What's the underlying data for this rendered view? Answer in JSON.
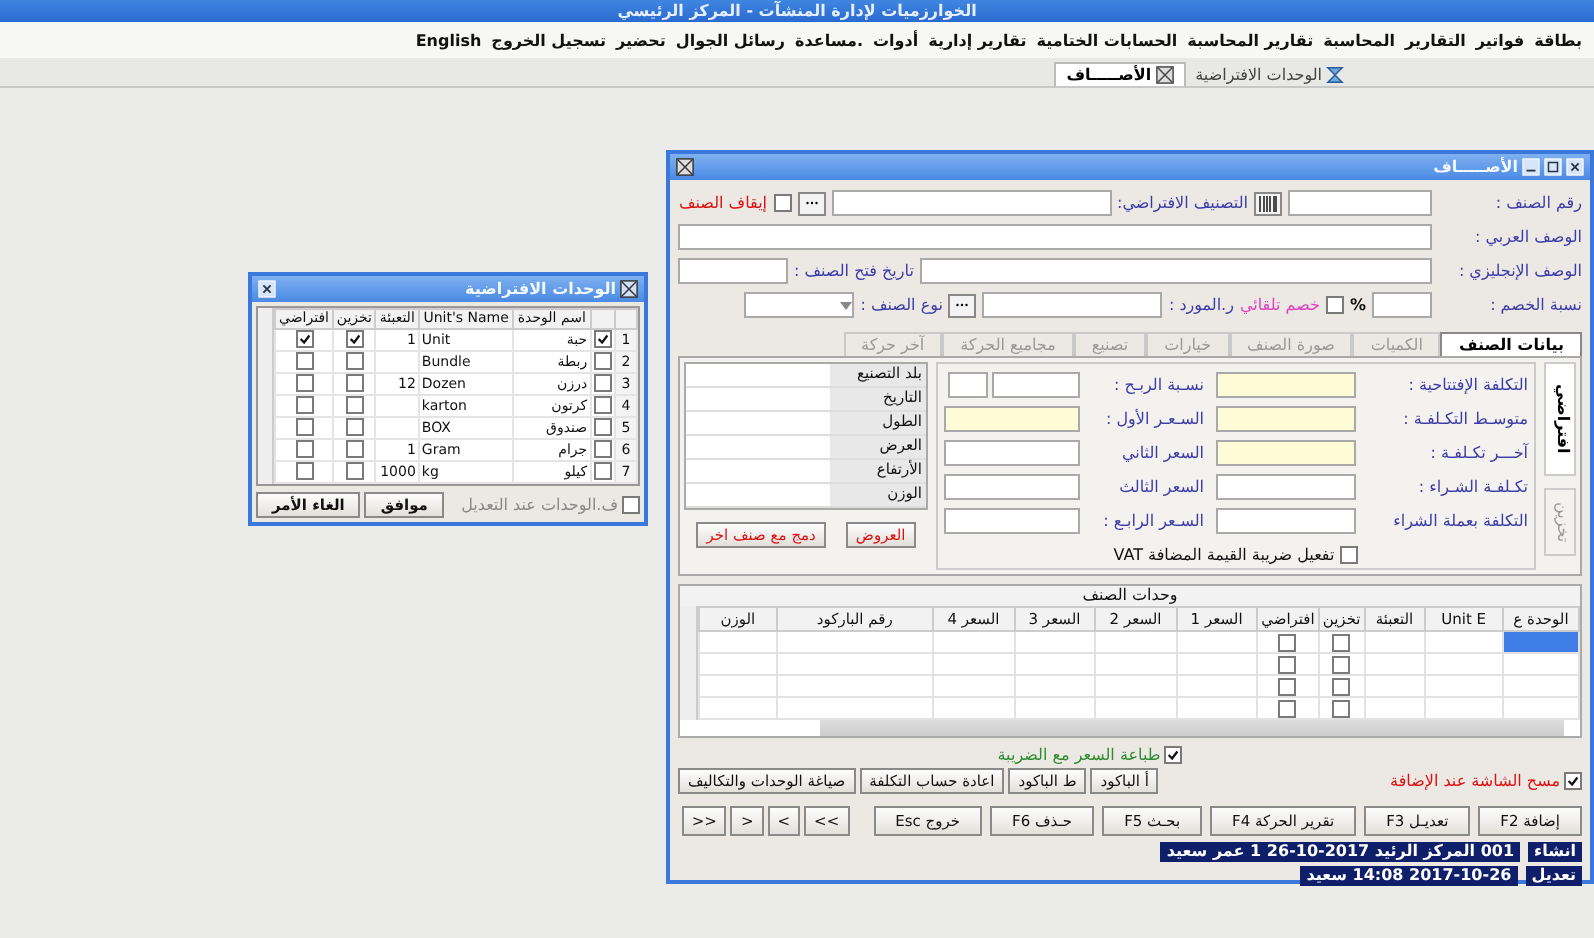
{
  "app_title": "الخوارزميات لإدارة المنشآت - المركز الرئيسي",
  "menu": [
    "بطاقة",
    "فواتير",
    "التقارير",
    "المحاسبة",
    "تقارير المحاسبة",
    "الحسابات الختامية",
    "تقارير إدارية",
    "أدوات",
    ".مساعدة",
    "رسائل الجوال",
    "تحضير",
    "تسجيل الخروج",
    "English"
  ],
  "doc_tabs": [
    {
      "label": "الوحدات الافتراضية",
      "selected": false
    },
    {
      "label": "الأصـــــاف",
      "selected": true
    }
  ],
  "items_window": {
    "title": "الأصـــــاف",
    "item_no": {
      "label": "رقم الصنف :"
    },
    "default_category": {
      "label": "التصنيف الافتراضي:"
    },
    "stop_item": {
      "label": "إيقاف الصنف",
      "checked": false
    },
    "arabic_desc": {
      "label": "الوصف العربي :"
    },
    "english_desc": {
      "label": "الوصف الإنجليزي :"
    },
    "open_date": {
      "label": "تاريخ فتح الصنف :"
    },
    "discount": {
      "label": "نسبة الخصم :",
      "unit": "%"
    },
    "auto_discount": {
      "label": "خصم تلقائي",
      "checked": false
    },
    "supplier": {
      "label": "ر.المورد :"
    },
    "item_type": {
      "label": "نوع الصنف :"
    },
    "tabs": [
      {
        "label": "بيانات الصنف",
        "selected": true
      },
      {
        "label": "الكميات",
        "selected": false
      },
      {
        "label": "صورة الصنف",
        "selected": false
      },
      {
        "label": "خيارات",
        "selected": false
      },
      {
        "label": "تصنيع",
        "selected": false
      },
      {
        "label": "مجاميع الحركة",
        "selected": false
      },
      {
        "label": "آخر حركة",
        "selected": false
      }
    ],
    "side_tabs": [
      {
        "label": "افتراضي",
        "selected": true
      },
      {
        "label": "تخزين",
        "selected": false
      }
    ],
    "cost_fields": [
      {
        "label": "التكلفة الإفتتاحية :",
        "highlighted": true
      },
      {
        "label": "متوسـط التكـلفـة :",
        "highlighted": true
      },
      {
        "label": "آخـــر تكـلفـة :",
        "highlighted": true
      },
      {
        "label": "تكـلفـة الشـراء :",
        "highlighted": false
      },
      {
        "label": "التكلفة بعملة الشراء",
        "highlighted": false
      }
    ],
    "price_fields": [
      {
        "label": "نسـبة الربـح :",
        "kind": "split",
        "highlighted": false
      },
      {
        "label": "السـعـر الأول :",
        "kind": "single",
        "highlighted": true
      },
      {
        "label": "السعر الثاني",
        "kind": "single",
        "highlighted": false
      },
      {
        "label": "السعر الثالث",
        "kind": "single",
        "highlighted": false
      },
      {
        "label": "السـعر الرابـع :",
        "kind": "single",
        "highlighted": false
      }
    ],
    "vat": {
      "label": "تفعيل ضريبة القيمة المضافة VAT",
      "checked": false
    },
    "properties": [
      "بلد التصنيع",
      "التاريخ",
      "الطول",
      "العرض",
      "الأرتفاع",
      "الوزن"
    ],
    "offers_button": "العروض",
    "merge_button": "دمج مع صنف اخر",
    "units_grid": {
      "title": "وحدات الصنف",
      "columns": [
        "الوحدة ع",
        "Unit E",
        "التعبئة",
        "تخزين",
        "افتراضي",
        "السعر 1",
        "السعر 2",
        "السعر 3",
        "السعر 4",
        "رقم الباركود",
        "الوزن"
      ],
      "rows": [
        {
          "selected": true,
          "store": false,
          "default": false
        },
        {
          "selected": false,
          "store": false,
          "default": false
        },
        {
          "selected": false,
          "store": false,
          "default": false
        },
        {
          "selected": false,
          "store": false,
          "default": false
        }
      ]
    },
    "print_with_tax": {
      "label": "طباعة السعر مع الضريبة",
      "checked": true
    },
    "clear_on_add": {
      "label": "مسح الشاشة عند الإضافة",
      "checked": true
    },
    "tool_buttons": [
      "أ الباكود",
      "ط الباكود",
      "اعادة حساب التكلفة",
      "صياغة الوحدات والتكاليف"
    ],
    "action_buttons": [
      "إضافة F2",
      "تعديـل F3",
      "تقرير الحركة F4",
      "بحـث F5",
      "حـذف F6",
      "خروج Esc"
    ],
    "nav_buttons": [
      ">>",
      ">",
      "<",
      "<<"
    ],
    "audit": [
      {
        "label": "انشاء",
        "value": "001 المركز الرئيد 2017-10-26 1 عمر سعيد"
      },
      {
        "label": "تعديل",
        "value": "2017-10-26 14:08 سعيد"
      }
    ]
  },
  "units_dialog": {
    "title": "الوحدات الافتراضية",
    "columns": [
      "اسم الوحدة",
      "Unit's Name",
      "التعبئة",
      "تخزين",
      "افتراضي"
    ],
    "rows": [
      {
        "no": "1",
        "checked": true,
        "name": "حبة",
        "unit_name": "Unit",
        "pack": "1",
        "store": true,
        "default": true
      },
      {
        "no": "2",
        "checked": false,
        "name": "ربطة",
        "unit_name": "Bundle",
        "store": false,
        "default": false
      },
      {
        "no": "3",
        "checked": false,
        "name": "درزن",
        "unit_name": "Dozen",
        "pack": "12",
        "store": false,
        "default": false
      },
      {
        "no": "4",
        "checked": false,
        "name": "كرتون",
        "unit_name": "karton",
        "store": false,
        "default": false
      },
      {
        "no": "5",
        "checked": false,
        "name": "صندوق",
        "unit_name": "BOX",
        "store": false,
        "default": false
      },
      {
        "no": "6",
        "checked": false,
        "name": "جرام",
        "unit_name": "Gram",
        "pack": "1",
        "store": false,
        "default": false
      },
      {
        "no": "7",
        "checked": false,
        "name": "كيلو",
        "unit_name": "kg",
        "pack": "1000",
        "store": false,
        "default": false
      }
    ],
    "edit_option": {
      "label": "ف.الوحدات عند التعديل",
      "checked": false
    },
    "ok_button": "موافق",
    "cancel_button": "الغاء الأمر"
  }
}
